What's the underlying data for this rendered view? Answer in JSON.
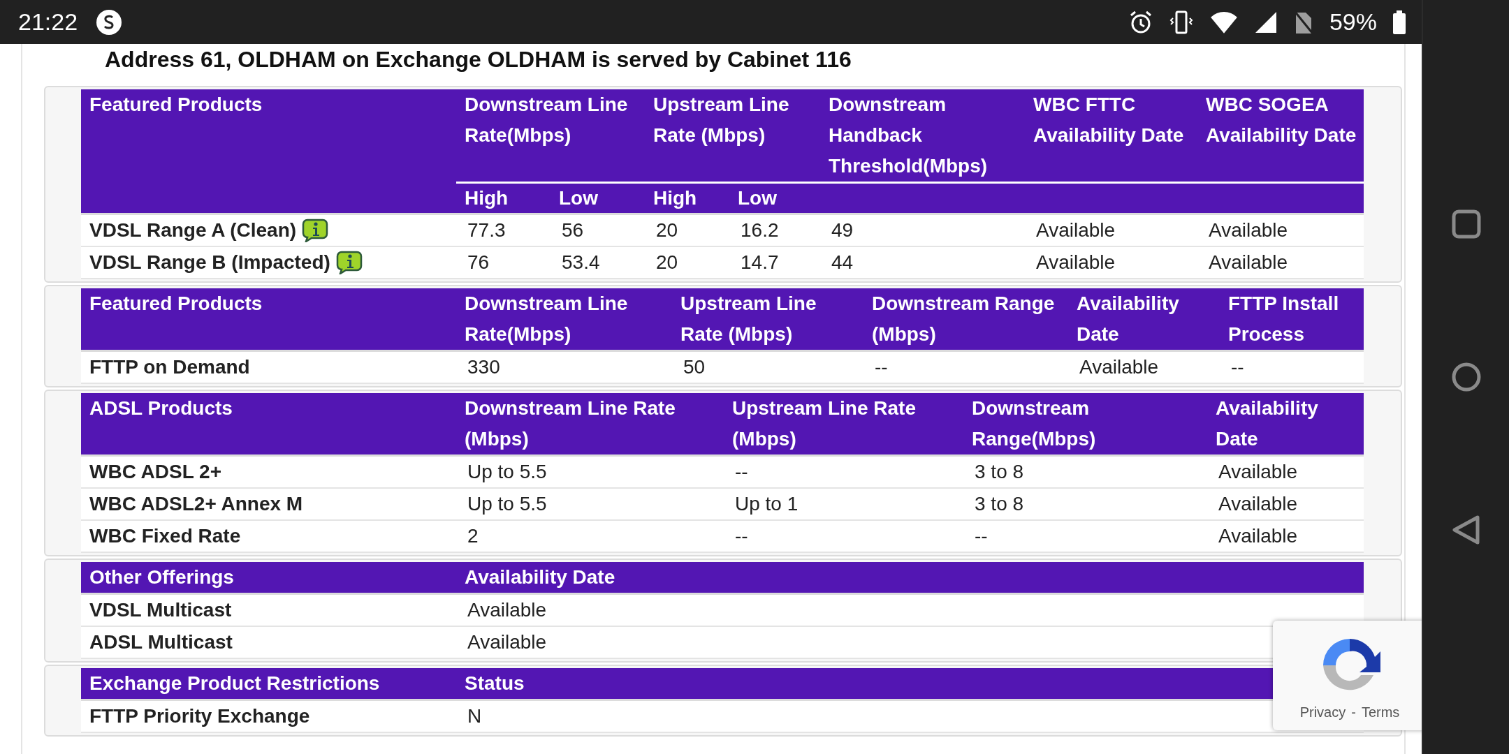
{
  "status_bar": {
    "time": "21:22",
    "battery": "59%"
  },
  "heading": "Address 61, OLDHAM on Exchange OLDHAM is served by Cabinet 116",
  "sections": [
    {
      "columns": [
        {
          "label": "Featured Products"
        },
        {
          "label": "Downstream Line Rate(Mbps)",
          "colspan": 2,
          "sub": [
            "High",
            "Low"
          ]
        },
        {
          "label": "Upstream Line Rate (Mbps)",
          "colspan": 2,
          "sub": [
            "High",
            "Low"
          ]
        },
        {
          "label": "Downstream Handback Threshold(Mbps)"
        },
        {
          "label": "WBC FTTC Availability Date"
        },
        {
          "label": "WBC SOGEA Availability Date"
        }
      ],
      "rows": [
        {
          "info": true,
          "cells": [
            "VDSL Range A (Clean)",
            "77.3",
            "56",
            "20",
            "16.2",
            "49",
            "Available",
            "Available"
          ]
        },
        {
          "info": true,
          "cells": [
            "VDSL Range B (Impacted)",
            "76",
            "53.4",
            "20",
            "14.7",
            "44",
            "Available",
            "Available"
          ]
        }
      ]
    },
    {
      "columns": [
        {
          "label": "Featured Products"
        },
        {
          "label": "Downstream Line Rate(Mbps)"
        },
        {
          "label": "Upstream Line Rate (Mbps)"
        },
        {
          "label": "Downstream Range (Mbps)"
        },
        {
          "label": "Availability Date"
        },
        {
          "label": "FTTP Install Process"
        }
      ],
      "rows": [
        {
          "info": false,
          "cells": [
            "FTTP on Demand",
            "330",
            "50",
            "--",
            "Available",
            "--"
          ]
        }
      ]
    },
    {
      "columns": [
        {
          "label": "ADSL Products"
        },
        {
          "label": "Downstream Line Rate (Mbps)"
        },
        {
          "label": "Upstream Line Rate (Mbps)"
        },
        {
          "label": "Downstream Range(Mbps)"
        },
        {
          "label": "Availability Date"
        }
      ],
      "rows": [
        {
          "info": false,
          "cells": [
            "WBC ADSL 2+",
            "Up to 5.5",
            "--",
            "3 to 8",
            "Available"
          ]
        },
        {
          "info": false,
          "cells": [
            "WBC ADSL2+ Annex M",
            "Up to 5.5",
            "Up to 1",
            "3 to 8",
            "Available"
          ]
        },
        {
          "info": false,
          "cells": [
            "WBC Fixed Rate",
            "2",
            "--",
            "--",
            "Available"
          ]
        }
      ]
    },
    {
      "columns": [
        {
          "label": "Other Offerings"
        },
        {
          "label": "Availability Date"
        }
      ],
      "rows": [
        {
          "info": false,
          "cells": [
            "VDSL Multicast",
            "Available"
          ]
        },
        {
          "info": false,
          "cells": [
            "ADSL Multicast",
            "Available"
          ]
        }
      ]
    },
    {
      "columns": [
        {
          "label": "Exchange Product Restrictions"
        },
        {
          "label": "Status"
        }
      ],
      "rows": [
        {
          "info": false,
          "cells": [
            "FTTP Priority Exchange",
            "N"
          ]
        }
      ]
    }
  ],
  "recaptcha": {
    "privacy": "Privacy",
    "separator": "-",
    "terms": "Terms"
  }
}
